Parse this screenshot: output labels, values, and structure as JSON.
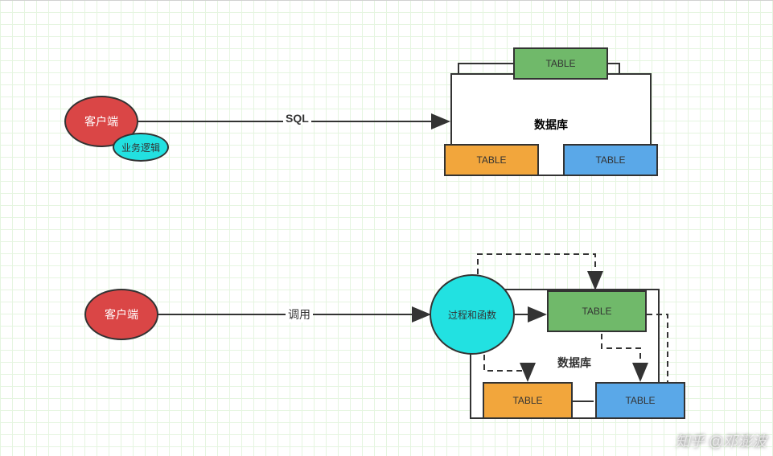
{
  "top": {
    "client": "客户端",
    "logic": "业务逻辑",
    "arrow_label": "SQL",
    "db_label": "数据库",
    "table1": "TABLE",
    "table2": "TABLE",
    "table3": "TABLE"
  },
  "bottom": {
    "client": "客户端",
    "arrow_label": "调用",
    "proc": "过程和函数",
    "db_label": "数据库",
    "table1": "TABLE",
    "table2": "TABLE",
    "table3": "TABLE"
  },
  "watermark": "知乎 @邓澎波"
}
